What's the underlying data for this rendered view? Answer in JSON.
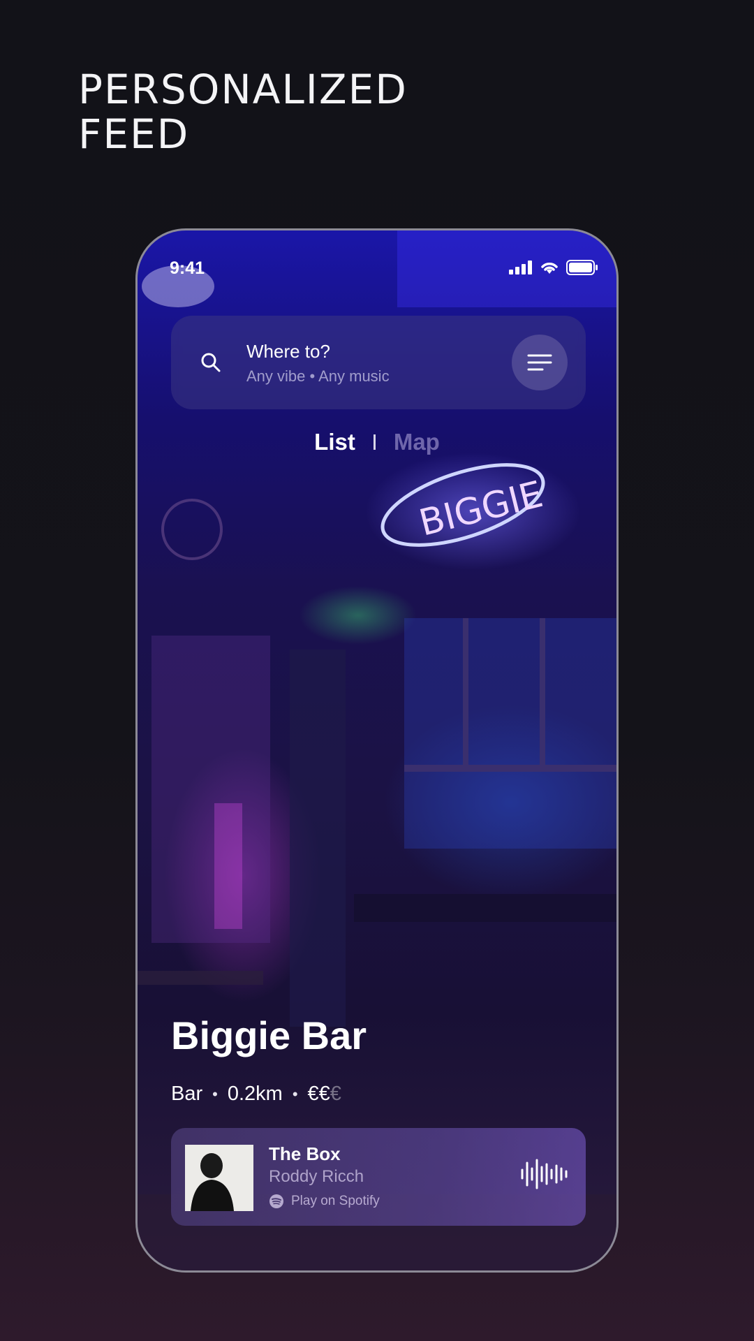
{
  "headline": {
    "line1": "PERSONALIZED",
    "line2": "FEED"
  },
  "status_bar": {
    "time": "9:41",
    "icons": [
      "cellular-signal-icon",
      "wifi-icon",
      "battery-icon"
    ]
  },
  "search": {
    "title": "Where to?",
    "subtitle": "Any vibe • Any music",
    "icon": "search-icon",
    "filter_icon": "filter-icon"
  },
  "view_toggle": {
    "list_label": "List",
    "map_label": "Map",
    "active": "List"
  },
  "venue": {
    "name": "Biggie Bar",
    "category": "Bar",
    "distance": "0.2km",
    "price_active": "€€",
    "price_inactive": "€",
    "sign_text": "BIGGIE"
  },
  "now_playing": {
    "track": "The Box",
    "artist": "Roddy Ricch",
    "action": "Play on Spotify",
    "icons": [
      "spotify-icon",
      "audio-waveform-icon"
    ]
  },
  "colors": {
    "background": "#121218",
    "accent": "#6a5cff",
    "map_inactive": "#968cc8"
  }
}
